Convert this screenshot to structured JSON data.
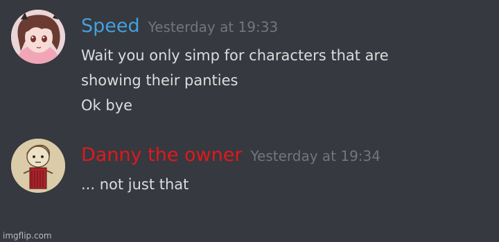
{
  "messages": [
    {
      "username": "Speed",
      "username_color": "#43a1e0",
      "timestamp": "Yesterday at 19:33",
      "lines": [
        "Wait you only simp for characters that are",
        "showing their panties",
        "Ok bye"
      ]
    },
    {
      "username": "Danny the owner",
      "username_color": "#e0191d",
      "timestamp": "Yesterday at 19:34",
      "lines": [
        "... not just that"
      ]
    }
  ],
  "watermark": "imgflip.com"
}
